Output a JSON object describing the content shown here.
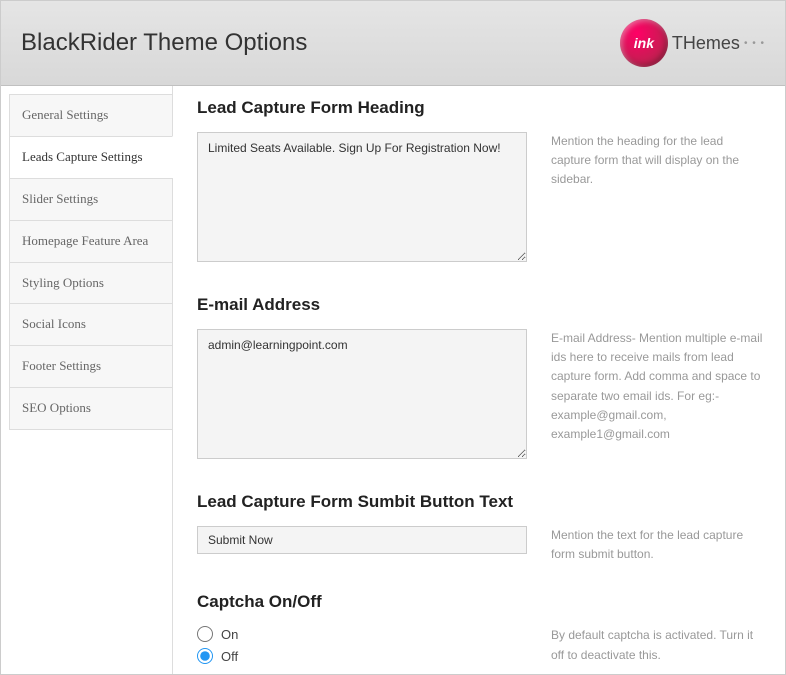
{
  "header": {
    "title": "BlackRider Theme Options",
    "logo_prefix": "ink",
    "logo_suffix": "THemes"
  },
  "sidebar": {
    "items": [
      {
        "label": "General Settings",
        "active": false
      },
      {
        "label": "Leads Capture Settings",
        "active": true
      },
      {
        "label": "Slider Settings",
        "active": false
      },
      {
        "label": "Homepage Feature Area",
        "active": false
      },
      {
        "label": "Styling Options",
        "active": false
      },
      {
        "label": "Social Icons",
        "active": false
      },
      {
        "label": "Footer Settings",
        "active": false
      },
      {
        "label": "SEO Options",
        "active": false
      }
    ]
  },
  "sections": {
    "heading": {
      "title": "Lead Capture Form Heading",
      "value": "Limited Seats Available. Sign Up For Registration Now!",
      "help": "Mention the heading for the lead capture form that will display on the sidebar."
    },
    "email": {
      "title": "E-mail Address",
      "value": "admin@learningpoint.com",
      "help": "E-mail Address- Mention multiple e-mail ids here to receive mails from lead capture form. Add comma and space to separate two email ids. For eg:- example@gmail.com, example1@gmail.com"
    },
    "submit": {
      "title": "Lead Capture Form Sumbit Button Text",
      "value": "Submit Now",
      "help": "Mention the text for the lead capture form submit button."
    },
    "captcha": {
      "title": "Captcha On/Off",
      "options": {
        "on": "On",
        "off": "Off"
      },
      "selected": "off",
      "help": "By default captcha is activated. Turn it off to deactivate this."
    }
  }
}
